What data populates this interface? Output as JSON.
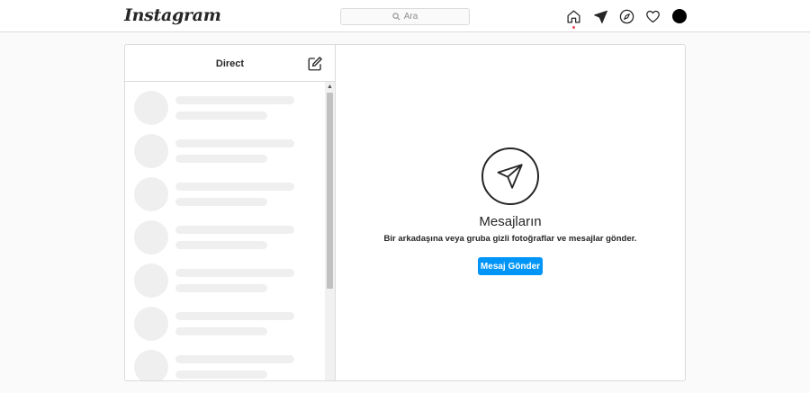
{
  "header": {
    "logo": "Instagram",
    "search_placeholder": "Ara",
    "nav_icons": [
      "home-icon",
      "direct-icon",
      "explore-icon",
      "heart-icon",
      "avatar"
    ]
  },
  "direct": {
    "title": "Direct",
    "compose_icon": "compose-icon",
    "placeholder_rows": 7
  },
  "empty_state": {
    "icon": "paper-plane-icon",
    "title": "Mesajların",
    "subtitle": "Bir arkadaşına veya gruba gizli fotoğraflar ve mesajlar gönder.",
    "button_label": "Mesaj Gönder"
  },
  "colors": {
    "accent": "#0095f6",
    "notification_dot": "#ed4956",
    "border": "#dbdbdb",
    "skeleton": "#efefef",
    "background": "#fafafa"
  }
}
